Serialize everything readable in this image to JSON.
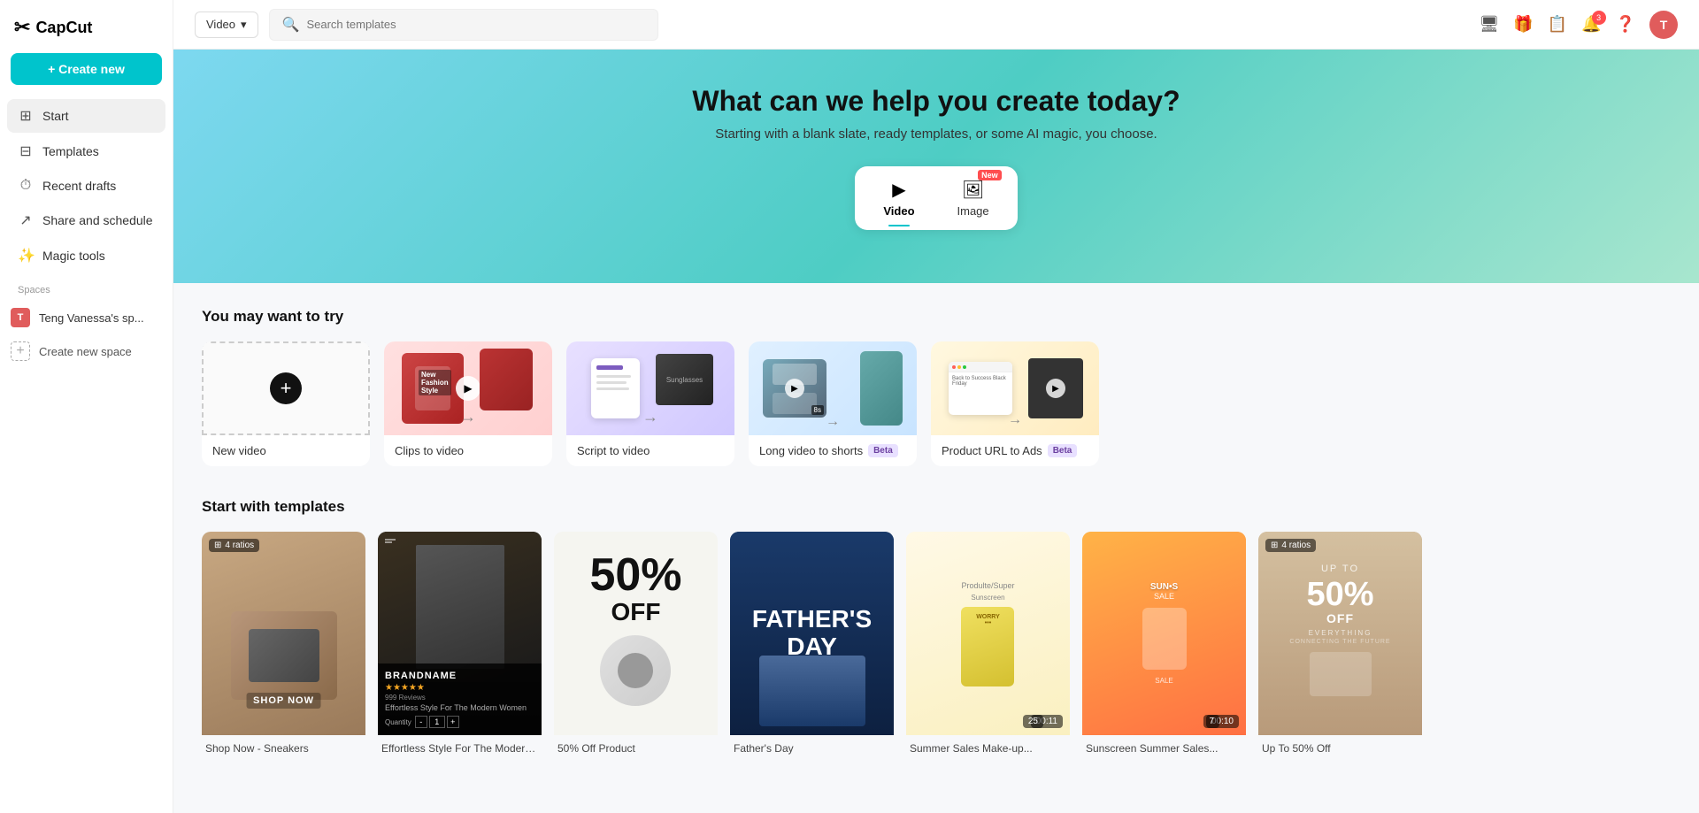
{
  "app": {
    "logo_text": "CapCut",
    "logo_icon": "✂"
  },
  "sidebar": {
    "create_btn": "+ Create new",
    "nav_items": [
      {
        "id": "start",
        "label": "Start",
        "icon": "⊞",
        "active": true
      },
      {
        "id": "templates",
        "label": "Templates",
        "icon": "⊟"
      },
      {
        "id": "recent_drafts",
        "label": "Recent drafts",
        "icon": "⏱"
      },
      {
        "id": "share_schedule",
        "label": "Share and schedule",
        "icon": "↗"
      },
      {
        "id": "magic_tools",
        "label": "Magic tools",
        "icon": "✨"
      }
    ],
    "spaces_label": "Spaces",
    "space_name": "Teng Vanessa's sp...",
    "create_space_label": "Create new space"
  },
  "topbar": {
    "video_filter": "Video",
    "search_placeholder": "Search templates",
    "icons": {
      "monitor": "🖥",
      "gift": "🎁",
      "calendar": "📅",
      "bell": "🔔",
      "help": "❓"
    },
    "notification_count": "3",
    "user_initial": "T"
  },
  "hero": {
    "title": "What can we help you create today?",
    "subtitle": "Starting with a blank slate, ready templates, or some AI magic, you choose.",
    "tabs": [
      {
        "id": "video",
        "label": "Video",
        "icon": "▶",
        "active": true
      },
      {
        "id": "image",
        "label": "Image",
        "icon": "🖼",
        "is_new": true,
        "new_label": "New"
      }
    ]
  },
  "try_section": {
    "title": "You may want to try",
    "cards": [
      {
        "id": "new_video",
        "label": "New video"
      },
      {
        "id": "clips_to_video",
        "label": "Clips to video"
      },
      {
        "id": "script_to_video",
        "label": "Script to video"
      },
      {
        "id": "long_video_to_shorts",
        "label": "Long video to shorts",
        "badge": "Beta"
      },
      {
        "id": "product_url_to_ads",
        "label": "Product URL to Ads",
        "badge": "Beta"
      }
    ]
  },
  "templates_section": {
    "title": "Start with templates",
    "cards": [
      {
        "id": "t1",
        "name": "Shop Now - Sneakers",
        "ratio": "4 ratios",
        "has_ratio": true,
        "theme": "t1"
      },
      {
        "id": "t2",
        "name": "Effortless Style For The Modern Women",
        "has_brandname": true,
        "theme": "t2"
      },
      {
        "id": "t3",
        "name": "50% Off Product",
        "theme": "t3"
      },
      {
        "id": "t4",
        "name": "Father's Day",
        "theme": "t4"
      },
      {
        "id": "t5",
        "name": "Summer Sales Make-up...",
        "duration": "00:11",
        "layers": "25",
        "has_ratio": false,
        "theme": "t5"
      },
      {
        "id": "t6",
        "name": "Sunscreen Summer Sales...",
        "duration": "00:10",
        "layers": "7",
        "theme": "t6",
        "has_ratio": false
      },
      {
        "id": "t7",
        "name": "Up To 50% Off",
        "ratio": "4 ratios",
        "has_ratio": true,
        "theme": "t7"
      }
    ]
  }
}
